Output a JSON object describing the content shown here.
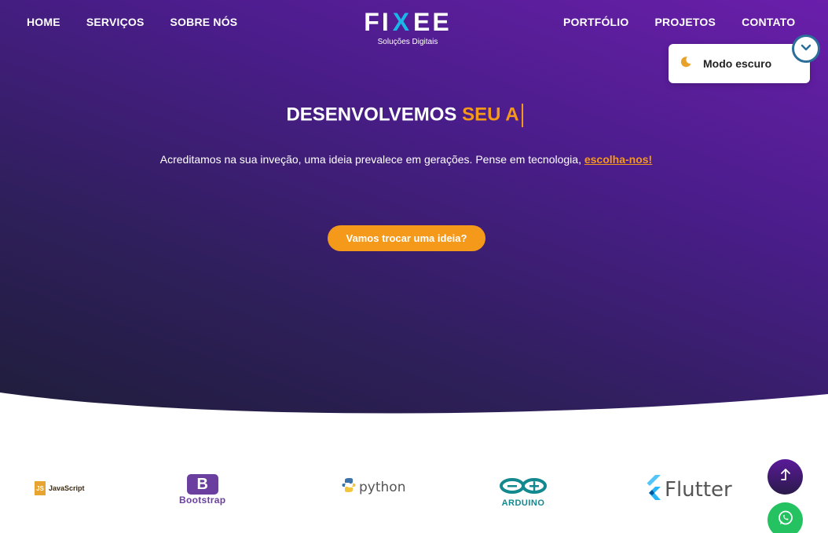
{
  "nav": {
    "left": [
      "HOME",
      "SERVIÇOS",
      "SOBRE NÓS"
    ],
    "right": [
      "PORTFÓLIO",
      "PROJETOS",
      "CONTATO"
    ]
  },
  "logo": {
    "brand_left": "FI",
    "brand_x": "X",
    "brand_right": "EE",
    "tagline": "Soluções Digitais"
  },
  "dark_mode": {
    "label": "Modo escuro",
    "icon": "moon-icon"
  },
  "hero": {
    "headline_white": "DESENVOLVEMOS",
    "headline_accent": "SEU A",
    "subtitle_text": "Acreditamos na sua inveção, uma ideia prevalece em gerações. Pense em tecnologia,",
    "subtitle_link": "escolha-nos!",
    "cta_label": "Vamos trocar uma ideia?"
  },
  "technologies": [
    {
      "name": "JavaScript",
      "badge": "JS"
    },
    {
      "name": "Bootstrap",
      "badge": "B"
    },
    {
      "name": "python"
    },
    {
      "name": "ARDUINO"
    },
    {
      "name": "Flutter"
    }
  ],
  "colors": {
    "accent": "#f4991a",
    "hero_top": "#6a1eab",
    "hero_bottom": "#1f1d3a",
    "whatsapp": "#25c262"
  }
}
